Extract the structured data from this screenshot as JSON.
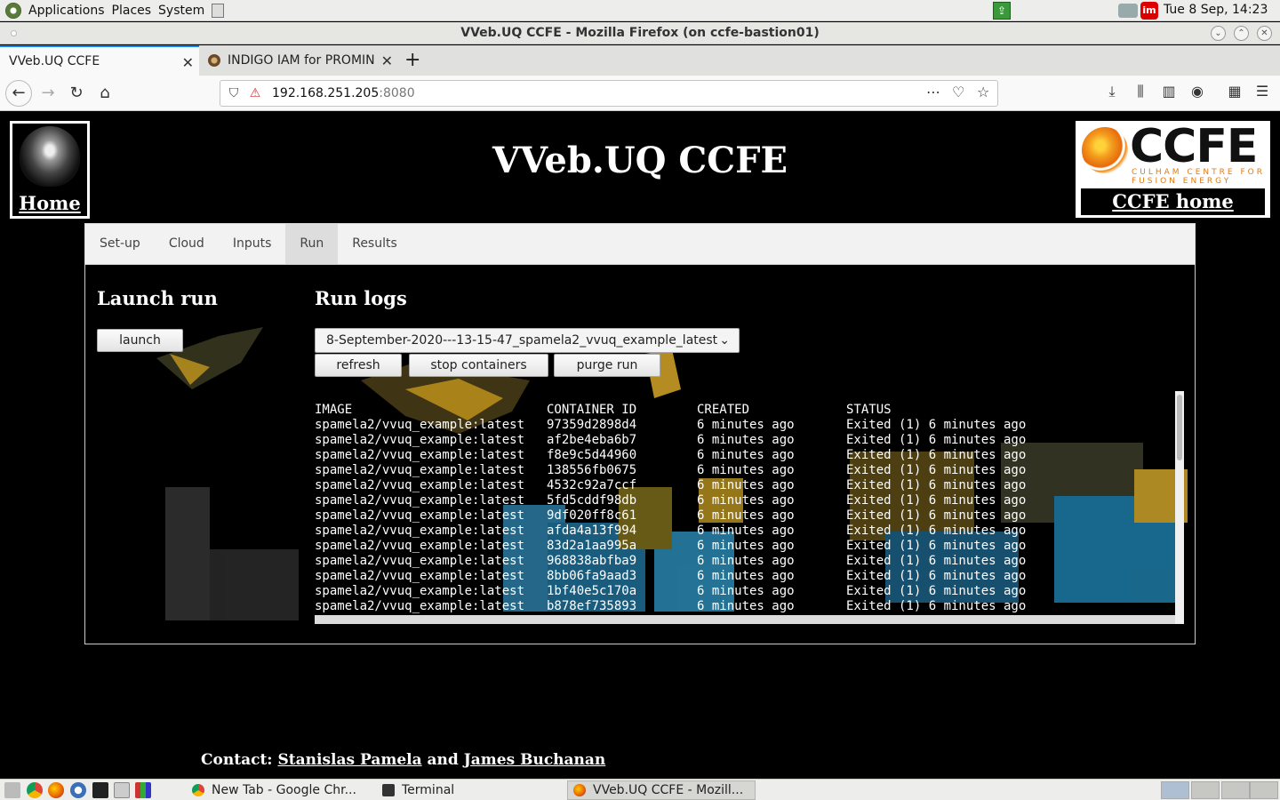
{
  "top_panel": {
    "menus": [
      "Applications",
      "Places",
      "System"
    ],
    "clock": "Tue  8 Sep, 14:23",
    "tray_red_label": "im"
  },
  "window": {
    "title": "VVeb.UQ CCFE - Mozilla Firefox (on ccfe-bastion01)"
  },
  "browser": {
    "tabs": [
      {
        "label": "VVeb.UQ CCFE",
        "active": true
      },
      {
        "label": "INDIGO IAM for PROMIN",
        "active": false
      }
    ],
    "url_host": "192.168.251.205",
    "url_port": ":8080",
    "icons": {
      "back": "back-arrow-icon",
      "forward": "forward-arrow-icon",
      "reload": "reload-icon",
      "home": "home-icon"
    }
  },
  "site": {
    "home_label": "Home",
    "title": "VVeb.UQ CCFE",
    "ccfe_logo_text": "CCFE",
    "ccfe_logo_sub1": "CULHAM CENTRE FOR",
    "ccfe_logo_sub2": "FUSION ENERGY",
    "ccfe_home_label": "CCFE home",
    "nav": [
      "Set-up",
      "Cloud",
      "Inputs",
      "Run",
      "Results"
    ],
    "active_nav": "Run"
  },
  "run": {
    "launch_heading": "Launch run",
    "launch_button": "launch",
    "logs_heading": "Run logs",
    "selected_run": "8-September-2020---13-15-47_spamela2_vvuq_example_latest",
    "buttons": {
      "refresh": "refresh",
      "stop": "stop containers",
      "purge": "purge run"
    },
    "log_headers": [
      "IMAGE",
      "CONTAINER ID",
      "CREATED",
      "STATUS"
    ],
    "log_rows": [
      [
        "spamela2/vvuq_example:latest",
        "97359d2898d4",
        "6 minutes ago",
        "Exited (1) 6 minutes ago"
      ],
      [
        "spamela2/vvuq_example:latest",
        "af2be4eba6b7",
        "6 minutes ago",
        "Exited (1) 6 minutes ago"
      ],
      [
        "spamela2/vvuq_example:latest",
        "f8e9c5d44960",
        "6 minutes ago",
        "Exited (1) 6 minutes ago"
      ],
      [
        "spamela2/vvuq_example:latest",
        "138556fb0675",
        "6 minutes ago",
        "Exited (1) 6 minutes ago"
      ],
      [
        "spamela2/vvuq_example:latest",
        "4532c92a7ccf",
        "6 minutes ago",
        "Exited (1) 6 minutes ago"
      ],
      [
        "spamela2/vvuq_example:latest",
        "5fd5cddf98db",
        "6 minutes ago",
        "Exited (1) 6 minutes ago"
      ],
      [
        "spamela2/vvuq_example:latest",
        "9df020ff8c61",
        "6 minutes ago",
        "Exited (1) 6 minutes ago"
      ],
      [
        "spamela2/vvuq_example:latest",
        "afda4a13f994",
        "6 minutes ago",
        "Exited (1) 6 minutes ago"
      ],
      [
        "spamela2/vvuq_example:latest",
        "83d2a1aa995a",
        "6 minutes ago",
        "Exited (1) 6 minutes ago"
      ],
      [
        "spamela2/vvuq_example:latest",
        "968838abfba9",
        "6 minutes ago",
        "Exited (1) 6 minutes ago"
      ],
      [
        "spamela2/vvuq_example:latest",
        "8bb06fa9aad3",
        "6 minutes ago",
        "Exited (1) 6 minutes ago"
      ],
      [
        "spamela2/vvuq_example:latest",
        "1bf40e5c170a",
        "6 minutes ago",
        "Exited (1) 6 minutes ago"
      ],
      [
        "spamela2/vvuq_example:latest",
        "b878ef735893",
        "6 minutes ago",
        "Exited (1) 6 minutes ago"
      ]
    ]
  },
  "contact": {
    "prefix": "Contact:",
    "name1": "Stanislas Pamela",
    "and": "and",
    "name2": "James Buchanan"
  },
  "taskbar": {
    "tasks": [
      {
        "label": "New Tab - Google Chr...",
        "active": false
      },
      {
        "label": "Terminal",
        "active": false
      },
      {
        "label": "VVeb.UQ CCFE - Mozill...",
        "active": true
      }
    ]
  }
}
